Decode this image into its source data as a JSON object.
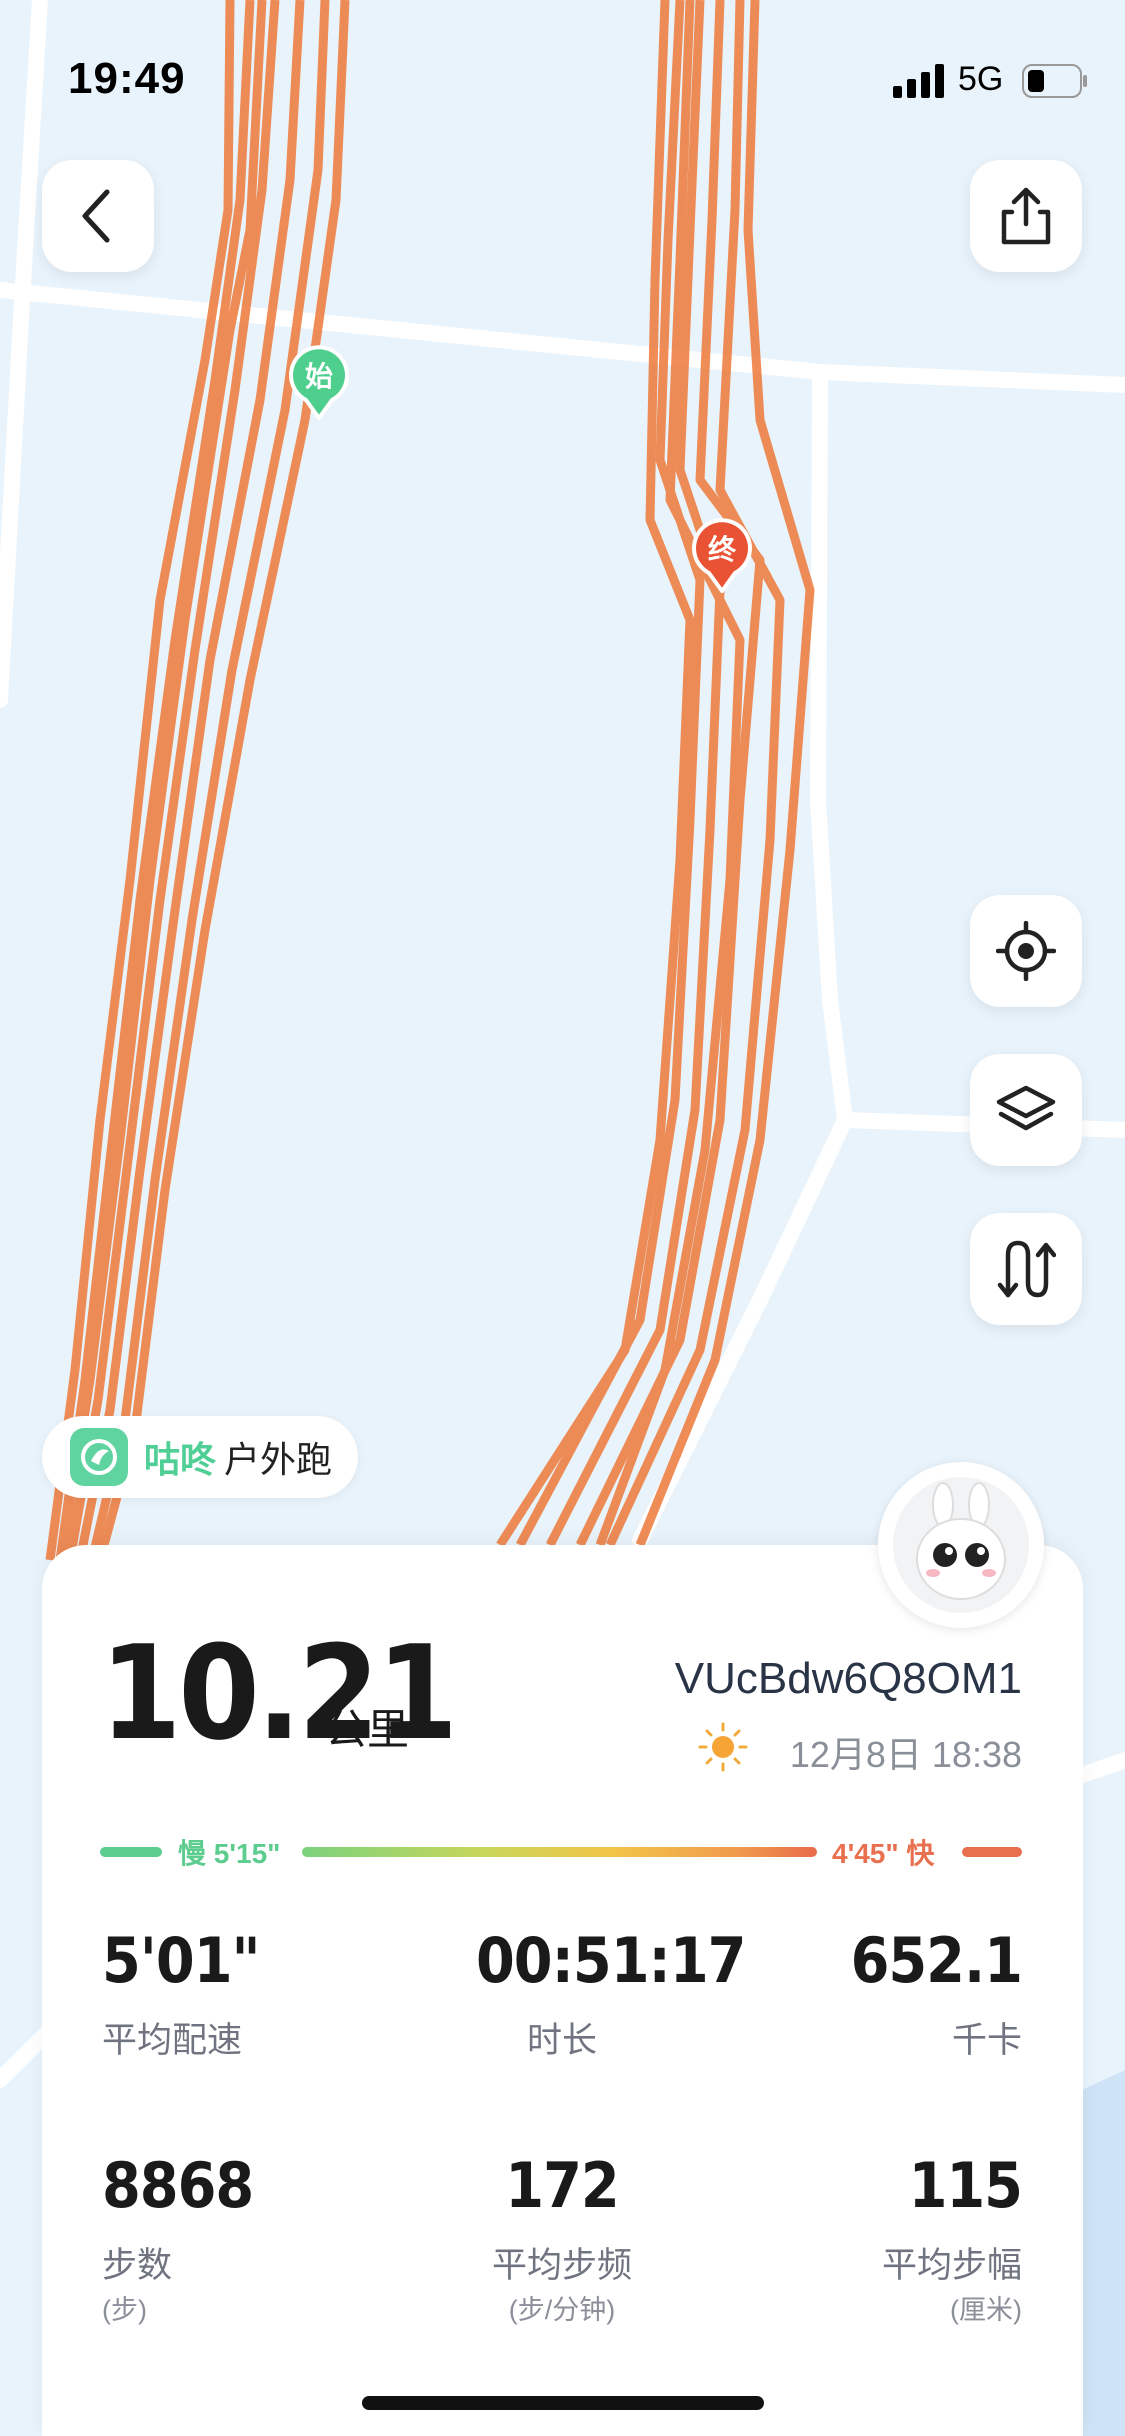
{
  "status_bar": {
    "time": "19:49",
    "network": "5G"
  },
  "map": {
    "start_marker": "始",
    "end_marker": "终",
    "route_color": "#ee7a3a"
  },
  "buttons": {
    "back_icon": "chevron-left-icon",
    "share_icon": "share-icon",
    "locate_icon": "locate-icon",
    "layers_icon": "layers-icon",
    "route_icon": "route-icon"
  },
  "brand": {
    "name": "咕咚",
    "activity": "户外跑"
  },
  "summary": {
    "distance": "10.21",
    "distance_unit": "公里",
    "user_id": "VUcBdw6Q8OM1",
    "weather_icon": "sun-icon",
    "datetime": "12月8日 18:38"
  },
  "pace_legend": {
    "slow_label": "慢 5'15\"",
    "fast_label": "4'45\" 快",
    "slow_color": "#5ccd8e",
    "fast_color": "#e8704f"
  },
  "stats": {
    "avg_pace": {
      "value": "5'01\"",
      "label": "平均配速"
    },
    "duration": {
      "value": "00:51:17",
      "label": "时长"
    },
    "calories": {
      "value": "652.1",
      "label": "千卡"
    },
    "steps": {
      "value": "8868",
      "label": "步数",
      "unit": "(步)"
    },
    "cadence": {
      "value": "172",
      "label": "平均步频",
      "unit": "(步/分钟)"
    },
    "stride": {
      "value": "115",
      "label": "平均步幅",
      "unit": "(厘米)"
    }
  }
}
